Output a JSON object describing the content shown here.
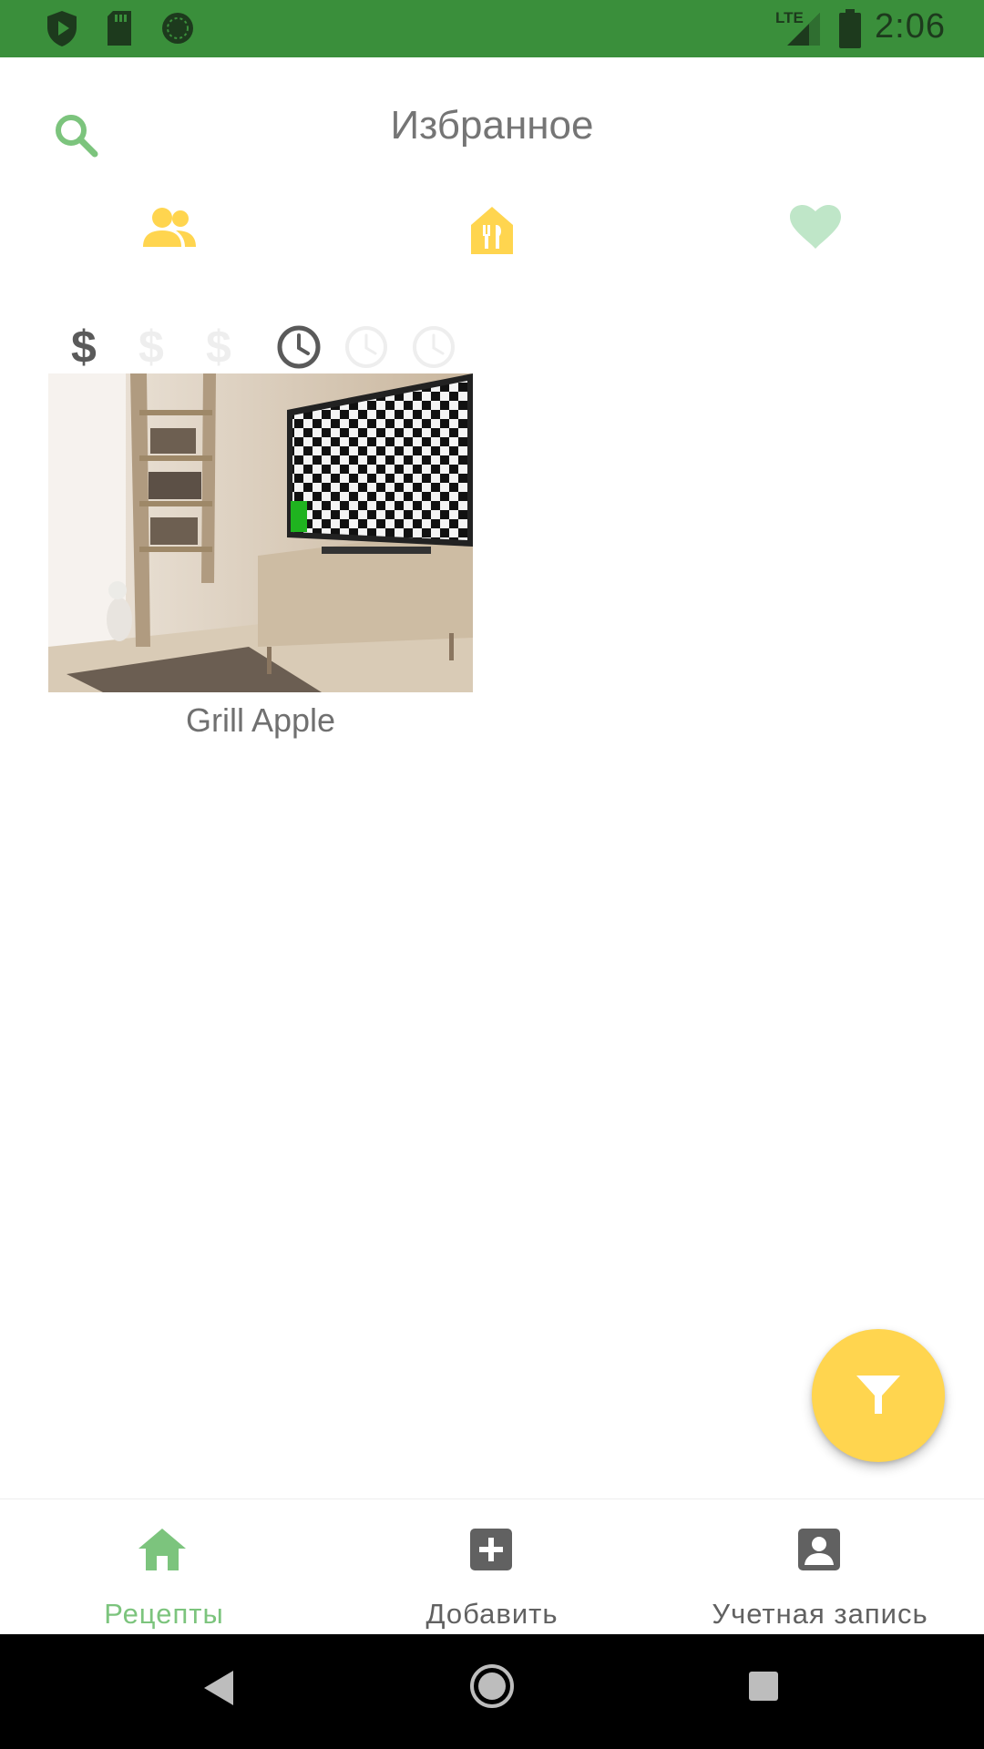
{
  "status_bar": {
    "time": "2:06",
    "network": "LTE",
    "left_icons": [
      "shield-play-icon",
      "sd-card-icon",
      "sync-circle-icon"
    ],
    "right_icons": [
      "signal-icon",
      "battery-icon"
    ]
  },
  "toolbar": {
    "title": "Избранное",
    "search_icon": "search-icon"
  },
  "tabs": [
    {
      "icon": "people-icon",
      "active": true
    },
    {
      "icon": "restaurant-icon",
      "active": false
    },
    {
      "icon": "heart-icon",
      "active": false
    }
  ],
  "filters": {
    "price_level": "$",
    "price_max": 3,
    "price_selected": 1,
    "time_max": 3,
    "time_selected": 1
  },
  "recipes": [
    {
      "title": "Grill Apple",
      "image": "room-with-cat-and-tv"
    }
  ],
  "fab": {
    "icon": "filter-icon"
  },
  "bottom_nav": [
    {
      "label": "Рецепты",
      "icon": "home-icon",
      "active": true
    },
    {
      "label": "Добавить",
      "icon": "add-box-icon",
      "active": false
    },
    {
      "label": "Учетная запись",
      "icon": "account-box-icon",
      "active": false
    }
  ],
  "colors": {
    "status_bar": "#3a8f3b",
    "accent_green": "#7cc47d",
    "accent_yellow": "#ffd54f",
    "text_gray": "#757575"
  }
}
